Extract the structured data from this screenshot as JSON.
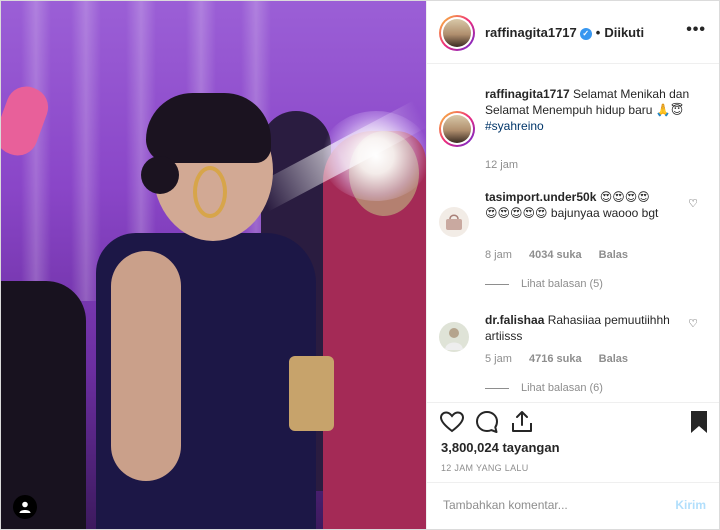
{
  "post": {
    "username": "raffinagita1717",
    "follow_status": "Diikuti",
    "more_label": "•••"
  },
  "caption": {
    "username": "raffinagita1717",
    "text": "Selamat Menikah dan Selamat Menempuh hidup baru",
    "emojis": "🙏😇",
    "hashtag": "#syahreino",
    "time": "12 jam"
  },
  "comments": [
    {
      "username": "tasimport.under50k",
      "emojis_line1": "😍😍😍😍",
      "emojis_line2": "😍😍😍😍😍",
      "text": "bajunyaa waooo bgt",
      "time": "8 jam",
      "likes": "4034 suka",
      "reply_label": "Balas",
      "view_replies": "Lihat balasan (5)"
    },
    {
      "username": "dr.falishaa",
      "text": "Rahasiiaa pemuutiihhh artiisss",
      "time": "5 jam",
      "likes": "4716 suka",
      "reply_label": "Balas",
      "view_replies": "Lihat balasan (6)"
    }
  ],
  "stats": {
    "views": "3,800,024 tayangan",
    "time_ago": "12 JAM YANG LALU"
  },
  "add_comment": {
    "placeholder": "Tambahkan komentar...",
    "post_label": "Kirim"
  },
  "icons": {
    "heart": "heart-icon",
    "comment": "comment-icon",
    "share": "share-icon",
    "save": "bookmark-icon"
  }
}
